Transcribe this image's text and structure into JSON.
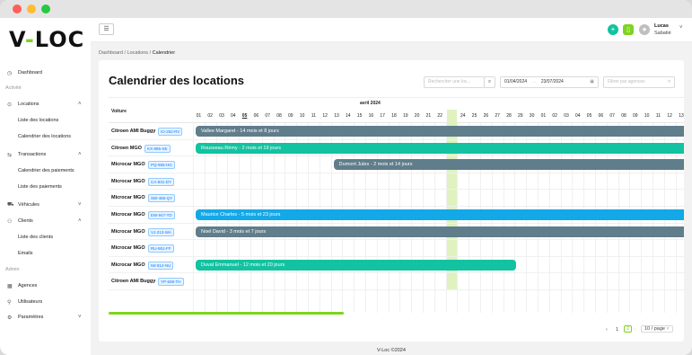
{
  "window": {
    "dots": [
      "#fe5f57",
      "#febc2e",
      "#28c840"
    ]
  },
  "logo": {
    "a": "V",
    "b": "-",
    "c": "LOC"
  },
  "sidebar": {
    "dashboard": "Dashboard",
    "section_activity": "Activité",
    "locations": "Locations",
    "list_locations": "Liste des locations",
    "calendar_locations": "Calendrier des locations",
    "transactions": "Transactions",
    "calendar_payments": "Calendrier des paiements",
    "list_payments": "Liste des paiements",
    "vehicles": "Véhicules",
    "clients": "Clients",
    "list_clients": "Liste des clients",
    "emails": "Emails",
    "section_admin": "Admin",
    "agencies": "Agences",
    "users": "Utilisateurs",
    "settings": "Paramètres"
  },
  "header": {
    "user_first": "Lucas",
    "user_last": "Sabatié"
  },
  "breadcrumb": {
    "a": "Dashboard",
    "b": "Locations",
    "c": "Calendrier"
  },
  "page": {
    "title": "Calendrier des locations"
  },
  "filters": {
    "search_placeholder": "Rechercher une loc...",
    "date_from": "01/04/2024",
    "date_sep": "→",
    "date_to": "23/07/2024",
    "agency_placeholder": "Filtrer par agences"
  },
  "calendar": {
    "vehicle_header": "Voiture",
    "month": "avril 2024",
    "days": [
      "01",
      "02",
      "03",
      "04",
      "05",
      "06",
      "07",
      "08",
      "09",
      "10",
      "11",
      "12",
      "13",
      "14",
      "15",
      "16",
      "17",
      "18",
      "19",
      "20",
      "21",
      "22",
      "23",
      "24",
      "25",
      "26",
      "27",
      "28",
      "29",
      "30",
      "01",
      "02",
      "03",
      "04",
      "05",
      "06",
      "07",
      "08",
      "09",
      "10",
      "11",
      "12",
      "13"
    ],
    "today_index": 22,
    "rows": [
      {
        "name": "Citroen AMI Buggy",
        "plate": "IO-252-RV",
        "bar": {
          "label": "Vallee Margaret - 14 mois et 8 jours",
          "start": 0,
          "color": "#607d8b"
        }
      },
      {
        "name": "Citroen MGO",
        "plate": "KX-895-SE",
        "bar": {
          "label": "Rousseau Rémy - 2 mois et 19 jours",
          "start": 0,
          "color": "#13c2a0"
        }
      },
      {
        "name": "Microcar MGO",
        "plate": "PQ-955-HG",
        "bar": {
          "label": "Dumont Jules - 2 mois et 14 jours",
          "start": 12,
          "color": "#607d8b"
        }
      },
      {
        "name": "Microcar MGO",
        "plate": "CA-931-DY",
        "bar": null
      },
      {
        "name": "Microcar MGO",
        "plate": "SW-455-QY",
        "bar": null
      },
      {
        "name": "Microcar MGO",
        "plate": "EW-947-TD",
        "bar": {
          "label": "Maurice Charles - 5 mois et 23 jours",
          "start": 0,
          "color": "#13a8e8"
        }
      },
      {
        "name": "Microcar MGO",
        "plate": "VJ-213-WA",
        "bar": {
          "label": "Noel David - 3 mois et 7 jours",
          "start": 0,
          "color": "#607d8b"
        }
      },
      {
        "name": "Microcar MGO",
        "plate": "RU-951-FF",
        "bar": null
      },
      {
        "name": "Microcar MGO",
        "plate": "IW-814-NU",
        "bar": {
          "label": "Duval Emmanuel - 12 mois et 20 jours",
          "start": 0,
          "end": 28,
          "color": "#13c2a0"
        }
      },
      {
        "name": "Citroen AMI Buggy",
        "plate": "YP-508-TH",
        "bar": null
      }
    ]
  },
  "pagination": {
    "page1": "1",
    "page2": "2",
    "size": "10 / page"
  },
  "footer": {
    "text": "V-Loc ©2024"
  },
  "colors": {
    "accent": "#7ed321",
    "teal": "#13c2a0",
    "blue": "#13a8e8",
    "slate": "#607d8b"
  }
}
